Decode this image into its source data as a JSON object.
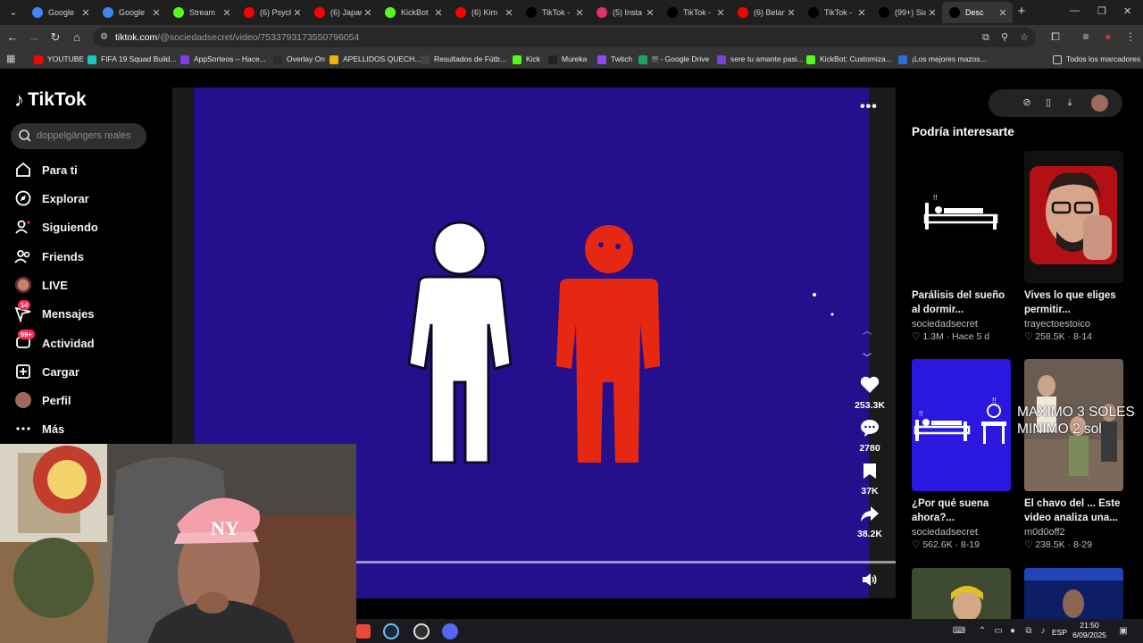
{
  "browser": {
    "tabs": [
      {
        "title": "Google",
        "color": "#4285f4",
        "icon": "google-icon"
      },
      {
        "title": "Google",
        "color": "#4285f4",
        "icon": "google-icon"
      },
      {
        "title": "Stream",
        "color": "#53fc18",
        "icon": "kick-icon"
      },
      {
        "title": "(6) Psych",
        "color": "#ff0000",
        "icon": "youtube-icon"
      },
      {
        "title": "(6) Japan",
        "color": "#ff0000",
        "icon": "youtube-icon"
      },
      {
        "title": "KickBot",
        "color": "#53fc18",
        "icon": "kickbot-icon"
      },
      {
        "title": "(6) Kim",
        "color": "#ff0000",
        "icon": "youtube-icon"
      },
      {
        "title": "TikTok -",
        "color": "#000000",
        "icon": "tiktok-icon"
      },
      {
        "title": "(5) Insta",
        "color": "#e1306c",
        "icon": "instagram-icon"
      },
      {
        "title": "TikTok -",
        "color": "#000000",
        "icon": "tiktok-icon"
      },
      {
        "title": "(6) Belan",
        "color": "#ff0000",
        "icon": "youtube-icon"
      },
      {
        "title": "TikTok -",
        "color": "#000000",
        "icon": "tiktok-icon"
      },
      {
        "title": "(99+) Sia",
        "color": "#000000",
        "icon": "tiktok-icon"
      },
      {
        "title": "Desc",
        "color": "#000000",
        "icon": "tiktok-icon",
        "active": true
      }
    ],
    "url_domain": "tiktok.com",
    "url_path": "/@sociedadsecret/video/7533793173550796054",
    "bookmarks": [
      {
        "label": "YOUTUBE",
        "color": "#ff0000"
      },
      {
        "label": "FIFA 19 Squad Build...",
        "color": "#1ec5c5"
      },
      {
        "label": "AppSorteos – Hace...",
        "color": "#7b3fe4"
      },
      {
        "label": "Overlay On",
        "color": "#2b2b2b"
      },
      {
        "label": "APELLIDOS QUECH...",
        "color": "#f0b400"
      },
      {
        "label": "Resultados de Fútb...",
        "color": "#444444"
      },
      {
        "label": "Kick",
        "color": "#53fc18"
      },
      {
        "label": "Mureka",
        "color": "#222222"
      },
      {
        "label": "Twitch",
        "color": "#9146ff"
      },
      {
        "label": "!!! - Google Drive",
        "color": "#1fa463"
      },
      {
        "label": "sere tu amante pasi...",
        "color": "#7b3fe4"
      },
      {
        "label": "KickBot: Customiza...",
        "color": "#53fc18"
      },
      {
        "label": "¡Los mejores mazos...",
        "color": "#2d6cdf"
      }
    ],
    "all_bookmarks_label": "Todos los marcadores"
  },
  "tiktok": {
    "logo": "TikTok",
    "search_placeholder": "doppelgängers reales",
    "nav": [
      {
        "label": "Para ti",
        "icon": "home-icon"
      },
      {
        "label": "Explorar",
        "icon": "compass-icon"
      },
      {
        "label": "Siguiendo",
        "icon": "following-icon"
      },
      {
        "label": "Friends",
        "icon": "friends-icon"
      },
      {
        "label": "LIVE",
        "icon": "live-icon"
      },
      {
        "label": "Mensajes",
        "icon": "messages-icon",
        "badge": "14"
      },
      {
        "label": "Actividad",
        "icon": "activity-icon",
        "badge": "99+"
      },
      {
        "label": "Cargar",
        "icon": "upload-icon"
      },
      {
        "label": "Perfil",
        "icon": "avatar-icon"
      },
      {
        "label": "Más",
        "icon": "more-icon"
      }
    ],
    "actions": {
      "likes": "253.3K",
      "comments": "2780",
      "saves": "37K",
      "shares": "38.2K"
    },
    "progress_fraction": 0.0,
    "recs_title": "Podría interesarte",
    "recs": [
      {
        "title": "Parálisis del sueño al dormir...",
        "author": "sociedadsecret",
        "likes": "1.3M",
        "date": "Hace 5 d"
      },
      {
        "title": "Vives lo que eliges permitir...",
        "author": "trayectoestoico",
        "likes": "258.5K",
        "date": "8-14"
      },
      {
        "title": "¿Por qué suena ahora?...",
        "author": "sociedadsecret",
        "likes": "562.6K",
        "date": "8-19"
      },
      {
        "title": "El chavo del ... Este video analiza una...",
        "author": "m0d0off2",
        "likes": "238.5K",
        "date": "8-29"
      }
    ],
    "overlay": "MAXIMO 3 SOLES\nMINIMO 2 sol"
  },
  "taskbar": {
    "time": "21:50",
    "date": "6/09/2025",
    "lang": "ESP"
  }
}
